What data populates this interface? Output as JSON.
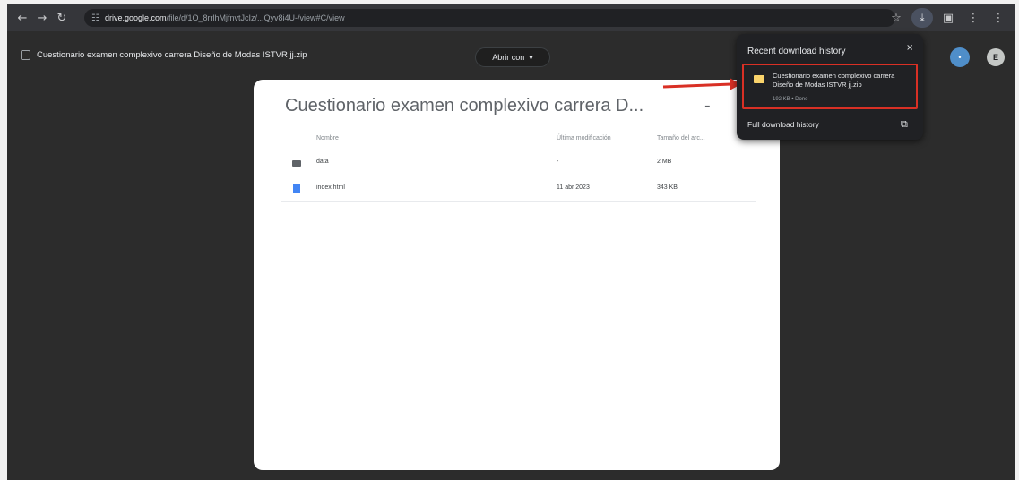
{
  "toolbar": {
    "back_icon": "←",
    "forward_icon": "→",
    "reload_icon": "↻",
    "site_icon": "☷",
    "url_host": "drive.google.com",
    "url_path": "/file/d/1O_8rrlhMjfnvtJcIz/...Qyv8i4U-/view#C/view",
    "star_icon": "☆",
    "download_icon": "⤓",
    "extension_icon": "▣",
    "profile_icon": "⋮",
    "menu_icon": "⋮"
  },
  "viewer": {
    "file_title": "Cuestionario examen complexivo carrera Diseño de Modas ISTVR jj.zip",
    "open_with_label": "Abrir con",
    "open_with_caret": "▾",
    "share_label": "•",
    "avatar_initial": "E"
  },
  "card": {
    "title": "Cuestionario examen complexivo carrera D...",
    "dash": "-",
    "headers": [
      "Nombre",
      "Última modificación",
      "Tamaño del arc..."
    ],
    "rows": [
      {
        "icon": "folder-icon",
        "name": "data",
        "modified": "-",
        "size": "2 MB"
      },
      {
        "icon": "html-file-icon",
        "name": "index.html",
        "modified": "11 abr 2023",
        "size": "343 KB"
      }
    ]
  },
  "downloads": {
    "title": "Recent download history",
    "close_icon": "×",
    "item_name": "Cuestionario examen complexivo carrera Diseño de Modas ISTVR jj.zip",
    "item_meta": "192 KB • Done",
    "full_history_label": "Full download history",
    "open_external_icon": "⧉"
  },
  "colors": {
    "highlight_border": "#d93025",
    "arrow": "#d93025"
  }
}
